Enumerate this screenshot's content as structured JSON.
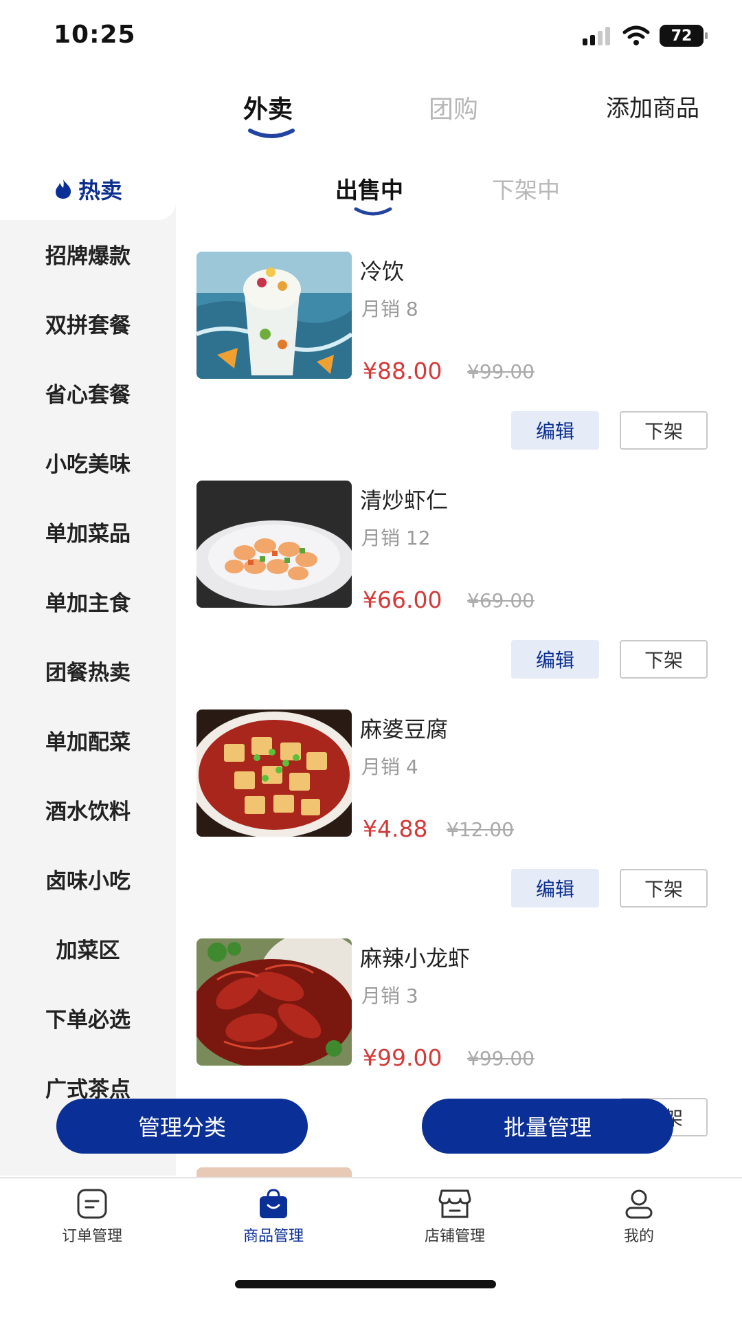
{
  "status_bar": {
    "time": "10:25",
    "battery": "72"
  },
  "top_tabs": {
    "items": [
      {
        "label": "外卖",
        "active": true
      },
      {
        "label": "团购",
        "active": false
      }
    ],
    "add_product_label": "添加商品"
  },
  "sub_tabs": {
    "items": [
      {
        "label": "出售中",
        "active": true
      },
      {
        "label": "下架中",
        "active": false
      }
    ]
  },
  "sidebar": {
    "active": {
      "label": "热卖",
      "icon": "flame-icon"
    },
    "items": [
      "招牌爆款",
      "双拼套餐",
      "省心套餐",
      "小吃美味",
      "单加菜品",
      "单加主食",
      "团餐热卖",
      "单加配菜",
      "酒水饮料",
      "卤味小吃",
      "加菜区",
      "下单必选",
      "广式茶点"
    ]
  },
  "products": [
    {
      "name": "冷饮",
      "sales": "月销 8",
      "price": "¥88.00",
      "original_price": "¥99.00",
      "edit_label": "编辑",
      "off_label": "下架"
    },
    {
      "name": "清炒虾仁",
      "sales": "月销 12",
      "price": "¥66.00",
      "original_price": "¥69.00",
      "edit_label": "编辑",
      "off_label": "下架"
    },
    {
      "name": "麻婆豆腐",
      "sales": "月销 4",
      "price": "¥4.88",
      "original_price": "¥12.00",
      "edit_label": "编辑",
      "off_label": "下架"
    },
    {
      "name": "麻辣小龙虾",
      "sales": "月销 3",
      "price": "¥99.00",
      "original_price": "¥99.00",
      "edit_label": "编辑",
      "off_label": "下架"
    }
  ],
  "actions": {
    "manage_category": "管理分类",
    "batch_manage": "批量管理"
  },
  "bottom_nav": [
    {
      "label": "订单管理",
      "icon": "order-icon",
      "active": false
    },
    {
      "label": "商品管理",
      "icon": "shopping-bag-icon",
      "active": true
    },
    {
      "label": "店铺管理",
      "icon": "store-icon",
      "active": false
    },
    {
      "label": "我的",
      "icon": "profile-icon",
      "active": false
    }
  ],
  "colors": {
    "brand": "#0A2F96",
    "price": "#D33A3A",
    "edit_bg": "#E6EBF8"
  }
}
